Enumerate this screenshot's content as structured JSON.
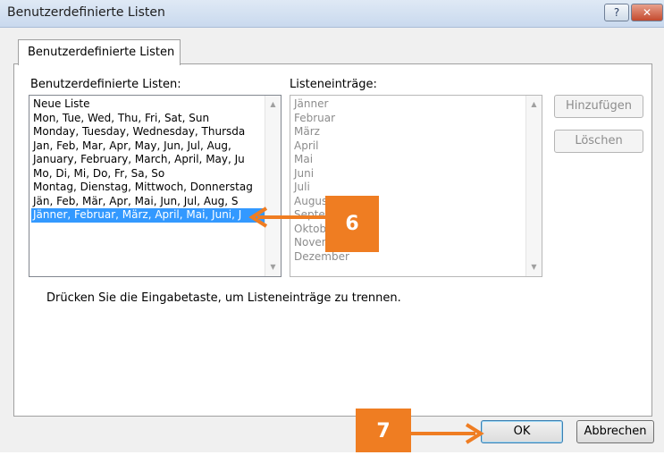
{
  "window": {
    "title": "Benutzerdefinierte Listen",
    "help_symbol": "?",
    "close_symbol": "✕"
  },
  "tab": {
    "label": "Benutzerdefinierte Listen"
  },
  "left_list": {
    "label": "Benutzerdefinierte Listen:",
    "items": [
      "Neue Liste",
      "Mon, Tue, Wed, Thu, Fri, Sat, Sun",
      "Monday, Tuesday, Wednesday, Thursda",
      "Jan, Feb, Mar, Apr, May, Jun, Jul, Aug,",
      "January, February, March, April, May, Ju",
      "Mo, Di, Mi, Do, Fr, Sa, So",
      "Montag, Dienstag, Mittwoch, Donnerstag",
      "Jän, Feb, Mär, Apr, Mai, Jun, Jul, Aug, S",
      "Jänner, Februar, März, April, Mai, Juni, J"
    ],
    "selected_index": 8
  },
  "right_list": {
    "label": "Listeneinträge:",
    "items": [
      "Jänner",
      "Februar",
      "März",
      "April",
      "Mai",
      "Juni",
      "Juli",
      "August",
      "September",
      "Oktober",
      "November",
      "Dezember"
    ]
  },
  "buttons": {
    "add": "Hinzufügen",
    "delete": "Löschen",
    "ok": "OK",
    "cancel": "Abbrechen"
  },
  "hint": "Drücken Sie die Eingabetaste, um Listeneinträge zu trennen.",
  "callouts": {
    "step6": "6",
    "step7": "7"
  },
  "colors": {
    "callout": "#ef7d22",
    "selection": "#3399ff"
  }
}
